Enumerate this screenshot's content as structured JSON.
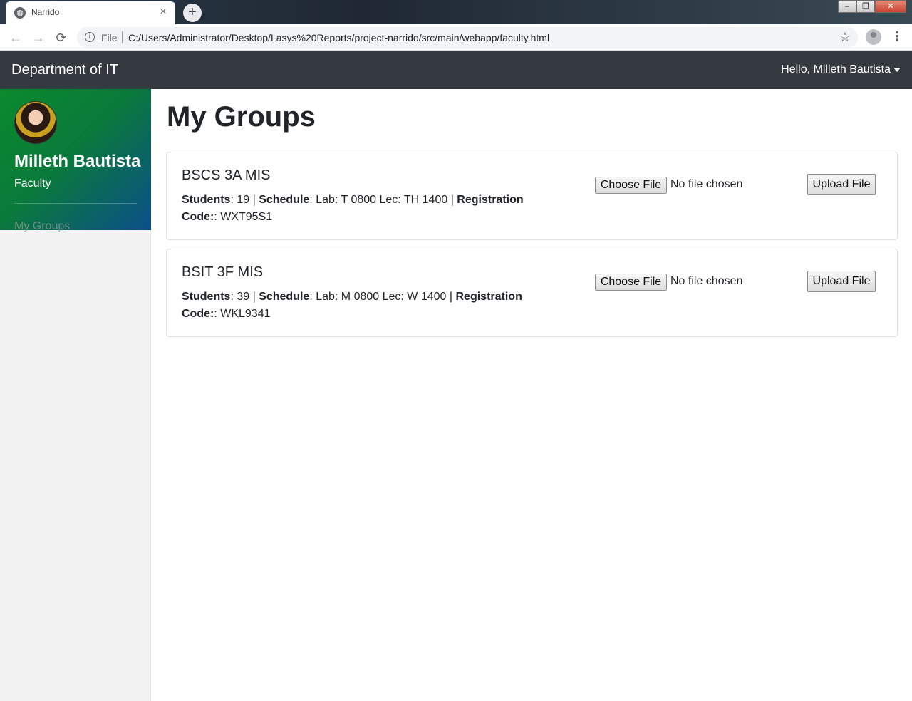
{
  "browser": {
    "tab_title": "Narrido",
    "tab_close": "×",
    "new_tab": "+",
    "omnibox_scheme": "File",
    "url": "C:/Users/Administrator/Desktop/Lasys%20Reports/project-narrido/src/main/webapp/faculty.html",
    "back_glyph": "←",
    "forward_glyph": "→",
    "reload_glyph": "⟳",
    "star_glyph": "☆",
    "menu_glyph": "⋮",
    "info_glyph": "i"
  },
  "navbar": {
    "brand": "Department of IT",
    "user_greeting": "Hello, Milleth Bautista"
  },
  "sidebar": {
    "profile_name": "Milleth Bautista",
    "profile_role": "Faculty",
    "links": [
      {
        "label": "My Groups"
      }
    ]
  },
  "main": {
    "title": "My Groups",
    "groups": [
      {
        "name": "BSCS 3A MIS",
        "students_label": "Students",
        "students": "19",
        "schedule_label": "Schedule",
        "schedule": "Lab: T 0800 Lec: TH 1400",
        "code_label": "Registration Code:",
        "code": "WXT95S1",
        "choose_label": "Choose File",
        "no_file_text": "No file chosen",
        "upload_label": "Upload File"
      },
      {
        "name": "BSIT 3F MIS",
        "students_label": "Students",
        "students": "39",
        "schedule_label": "Schedule",
        "schedule": "Lab: M 0800 Lec: W 1400",
        "code_label": "Registration Code:",
        "code": "WKL9341",
        "choose_label": "Choose File",
        "no_file_text": "No file chosen",
        "upload_label": "Upload File"
      }
    ]
  },
  "colors": {
    "navbar": "#343a40",
    "sidebar_gradient_start": "#0a8a2e",
    "sidebar_gradient_end": "#0b4f8a",
    "sidebar_bg": "#f2f2f2"
  }
}
